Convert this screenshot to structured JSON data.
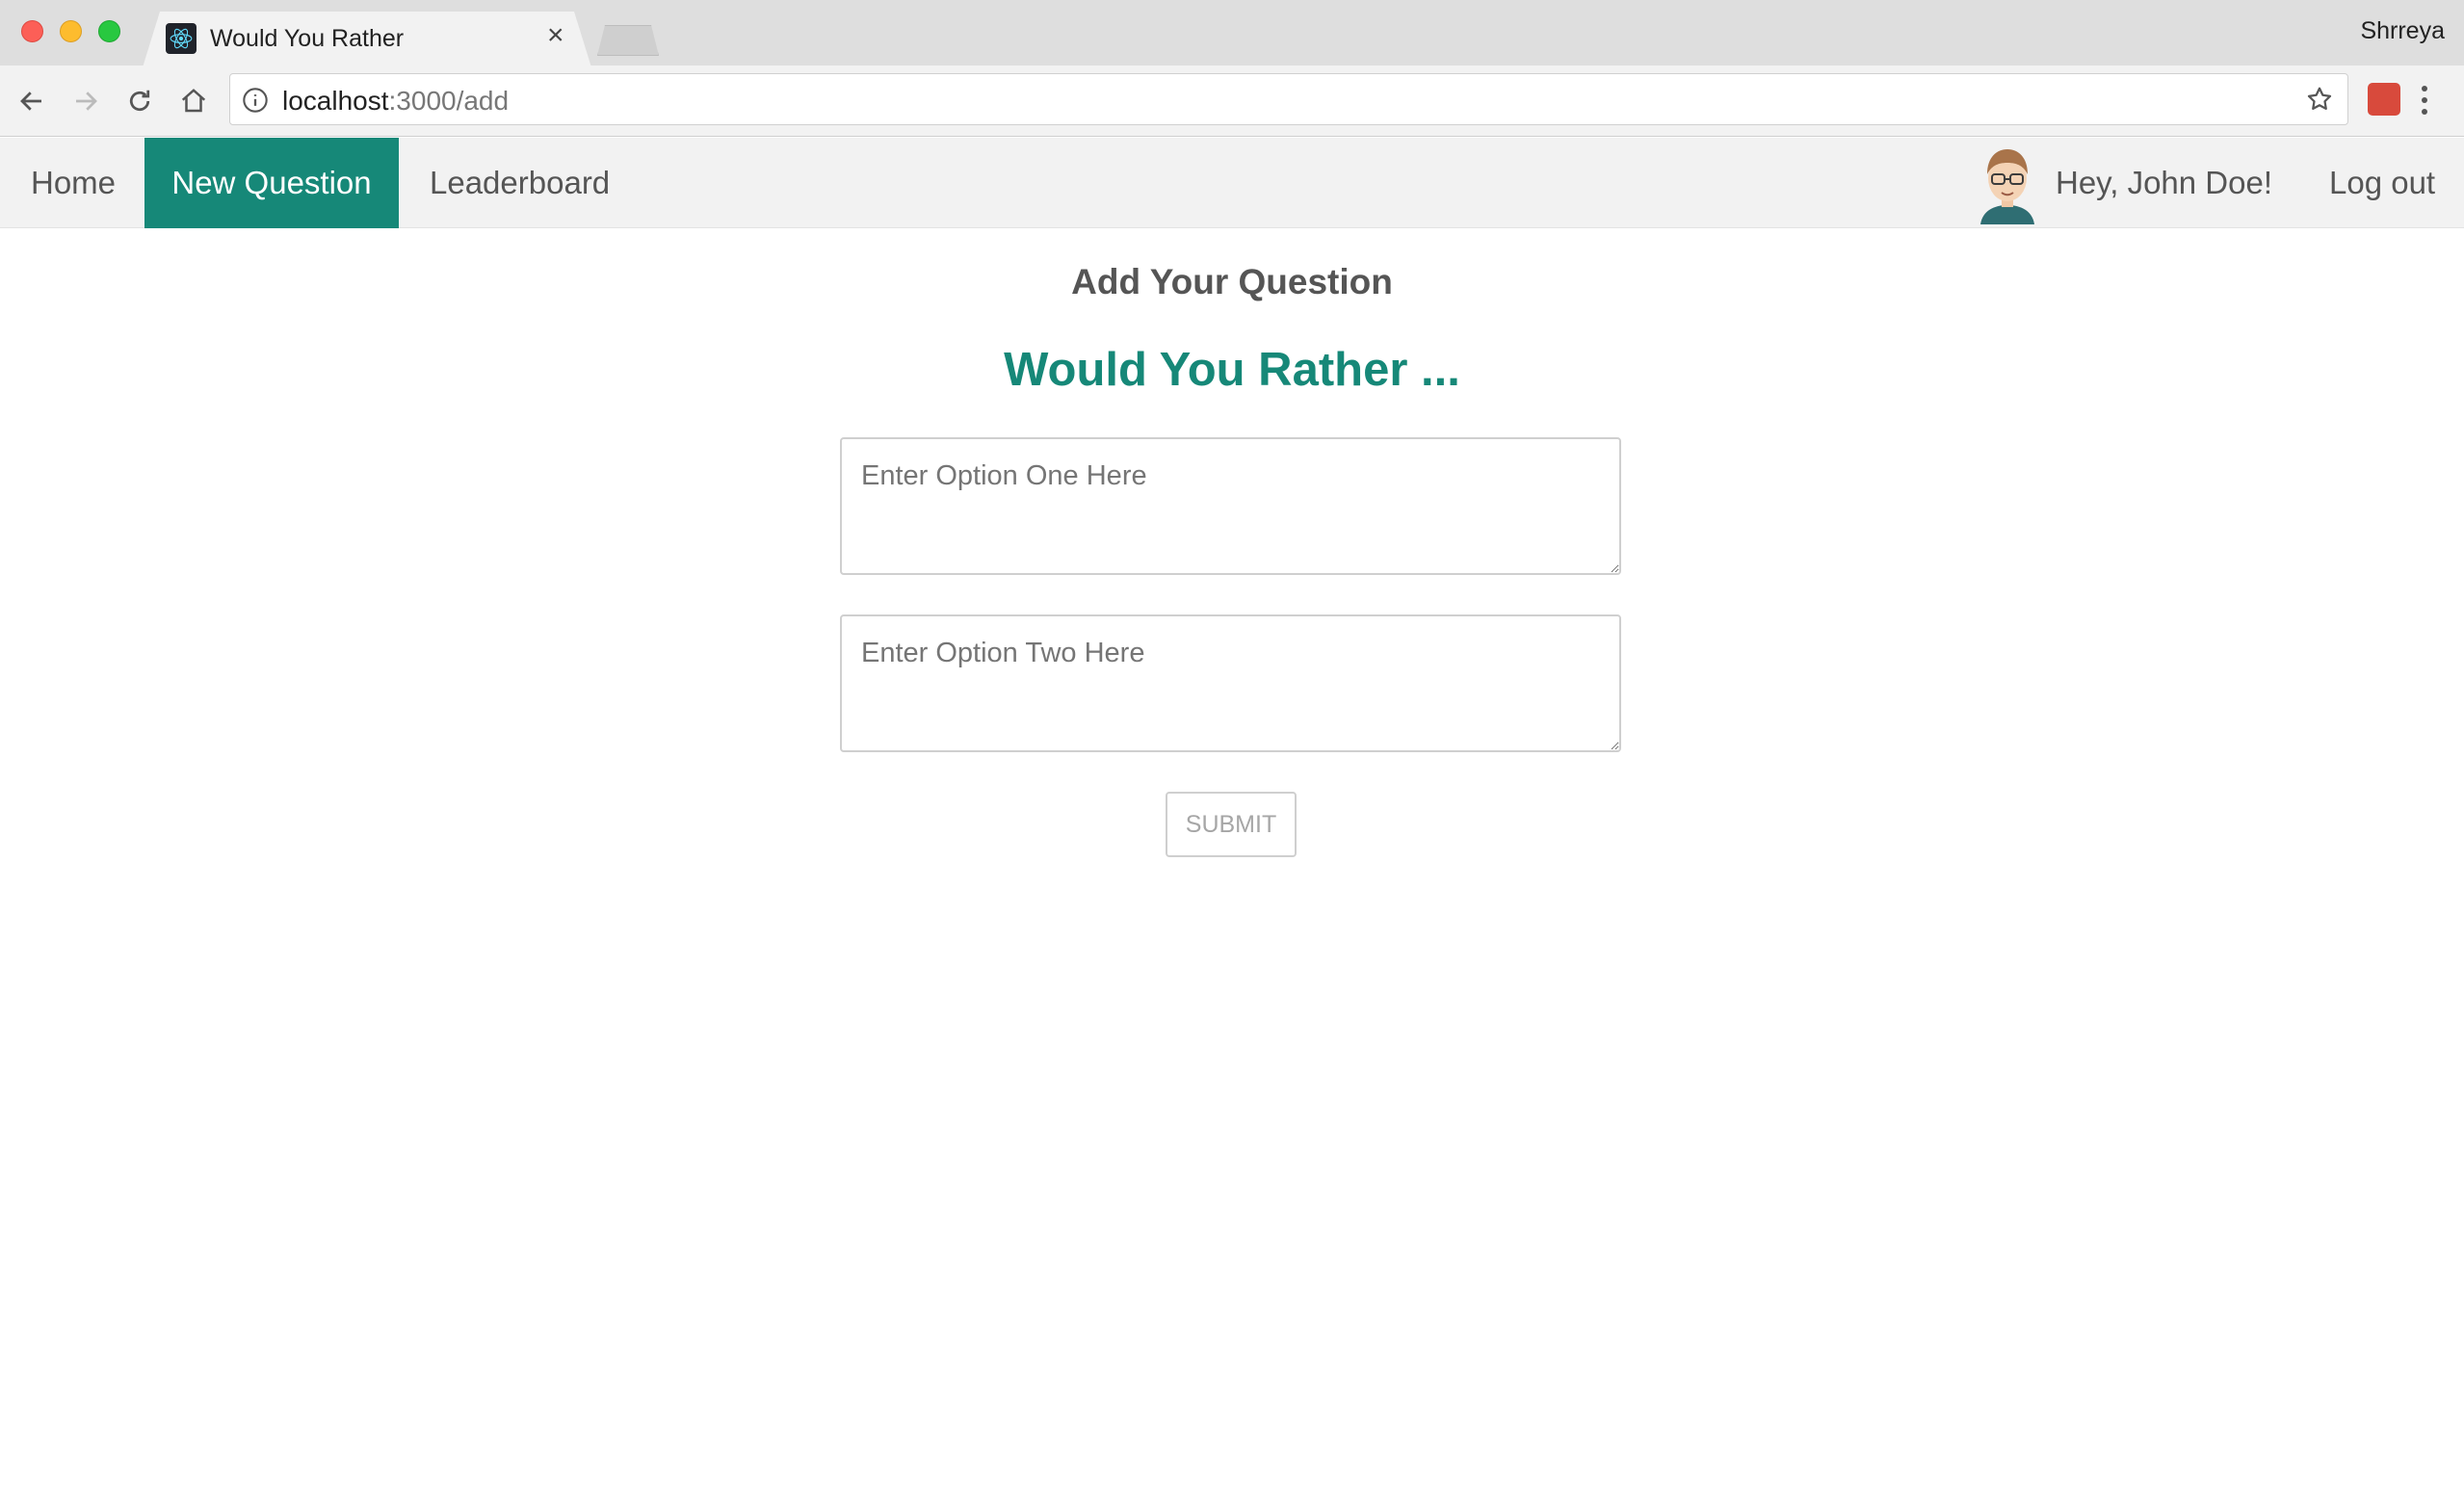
{
  "browser": {
    "tab_title": "Would You Rather",
    "tab_close": "×",
    "profile_name": "Shrreya",
    "url_host": "localhost",
    "url_path": ":3000/add"
  },
  "nav": {
    "home": "Home",
    "new_question": "New Question",
    "leaderboard": "Leaderboard",
    "greeting": "Hey, John Doe!",
    "logout": "Log out",
    "active_color": "#168878"
  },
  "main": {
    "heading": "Add Your Question",
    "title": "Would You Rather ...",
    "option_one_placeholder": "Enter Option One Here",
    "option_two_placeholder": "Enter Option Two Here",
    "submit_label": "SUBMIT"
  },
  "icons": [
    "react-favicon-icon",
    "back-arrow-icon",
    "forward-arrow-icon",
    "reload-icon",
    "home-icon",
    "info-icon",
    "bookmark-star-icon",
    "extension-icon",
    "menu-dots-icon",
    "user-avatar"
  ]
}
